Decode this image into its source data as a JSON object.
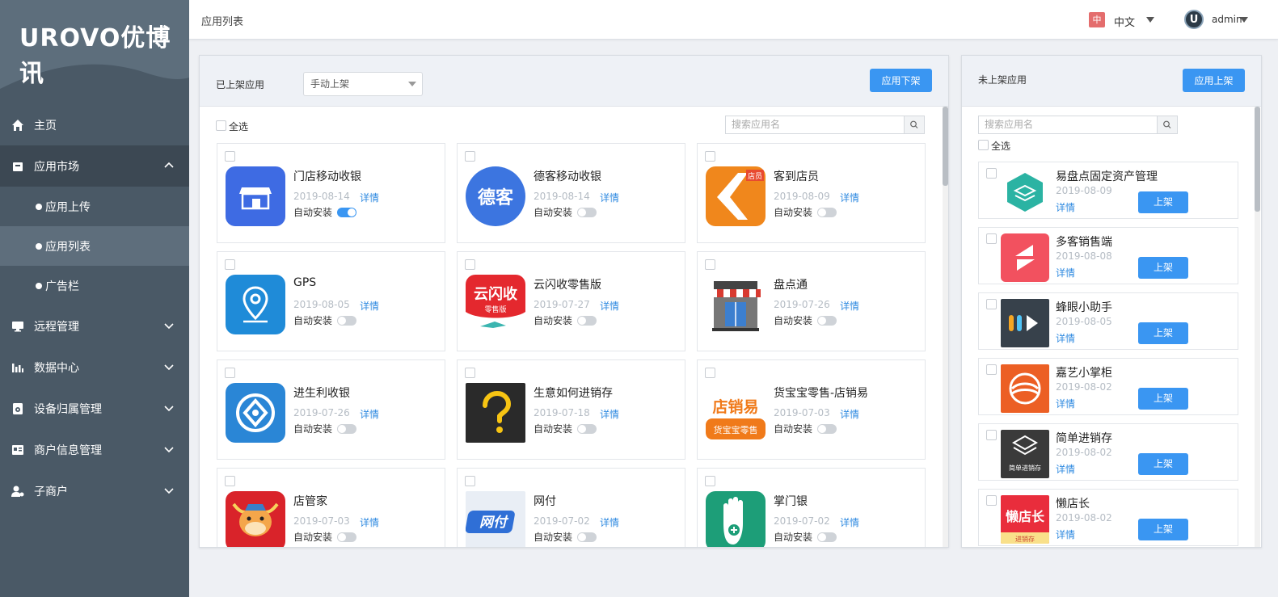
{
  "brand": {
    "logo_text": "UROVO优博讯"
  },
  "menu": {
    "home": "主页",
    "app_market": "应用市场",
    "app_upload": "应用上传",
    "app_list": "应用列表",
    "banner": "广告栏",
    "remote": "远程管理",
    "data_center": "数据中心",
    "device_owner": "设备归属管理",
    "merchant_info": "商户信息管理",
    "sub_merchant": "子商户"
  },
  "topbar": {
    "title": "应用列表",
    "lang_badge": "中",
    "lang": "中文",
    "user": "admin"
  },
  "left_panel": {
    "label": "已上架应用",
    "filter_value": "手动上架",
    "unshelve_button": "应用下架",
    "select_all": "全选",
    "search_placeholder": "搜索应用名",
    "detail_label": "详情",
    "auto_install_label": "自动安装",
    "apps": [
      {
        "name": "门店移动收银",
        "date": "2019-08-14",
        "auto_install": true
      },
      {
        "name": "德客移动收银",
        "date": "2019-08-14",
        "auto_install": false
      },
      {
        "name": "客到店员",
        "date": "2019-08-09",
        "auto_install": false
      },
      {
        "name": "GPS",
        "date": "2019-08-05",
        "auto_install": false
      },
      {
        "name": "云闪收零售版",
        "date": "2019-07-27",
        "auto_install": false
      },
      {
        "name": "盘点通",
        "date": "2019-07-26",
        "auto_install": false
      },
      {
        "name": "进生利收银",
        "date": "2019-07-26",
        "auto_install": false
      },
      {
        "name": "生意如何进销存",
        "date": "2019-07-18",
        "auto_install": false
      },
      {
        "name": "货宝宝零售-店销易",
        "date": "2019-07-03",
        "auto_install": false
      },
      {
        "name": "店管家",
        "date": "2019-07-03",
        "auto_install": false
      },
      {
        "name": "网付",
        "date": "2019-07-02",
        "auto_install": false
      },
      {
        "name": "掌门银",
        "date": "2019-07-02",
        "auto_install": false
      }
    ],
    "icon_text": {
      "deke": "德客",
      "yunshan": "云闪收",
      "yunshan_sub": "零售版",
      "dianxiao": "店销易",
      "huobao": "货宝宝零售",
      "wangfu": "网付",
      "kedao": "店员"
    }
  },
  "right_panel": {
    "label": "未上架应用",
    "shelve_button": "应用上架",
    "search_placeholder": "搜索应用名",
    "select_all": "全选",
    "detail_label": "详情",
    "shelve_label": "上架",
    "apps": [
      {
        "name": "易盘点固定资产管理",
        "date": "2019-08-09"
      },
      {
        "name": "多客销售端",
        "date": "2019-08-08"
      },
      {
        "name": "蜂眼小助手",
        "date": "2019-08-05"
      },
      {
        "name": "嘉艺小掌柜",
        "date": "2019-08-02"
      },
      {
        "name": "简单进销存",
        "date": "2019-08-02"
      },
      {
        "name": "懒店长",
        "date": "2019-08-02"
      }
    ],
    "icon_text": {
      "jiandan": "简单进销存",
      "landian": "懒店长",
      "landian_sub": "进销存"
    }
  }
}
